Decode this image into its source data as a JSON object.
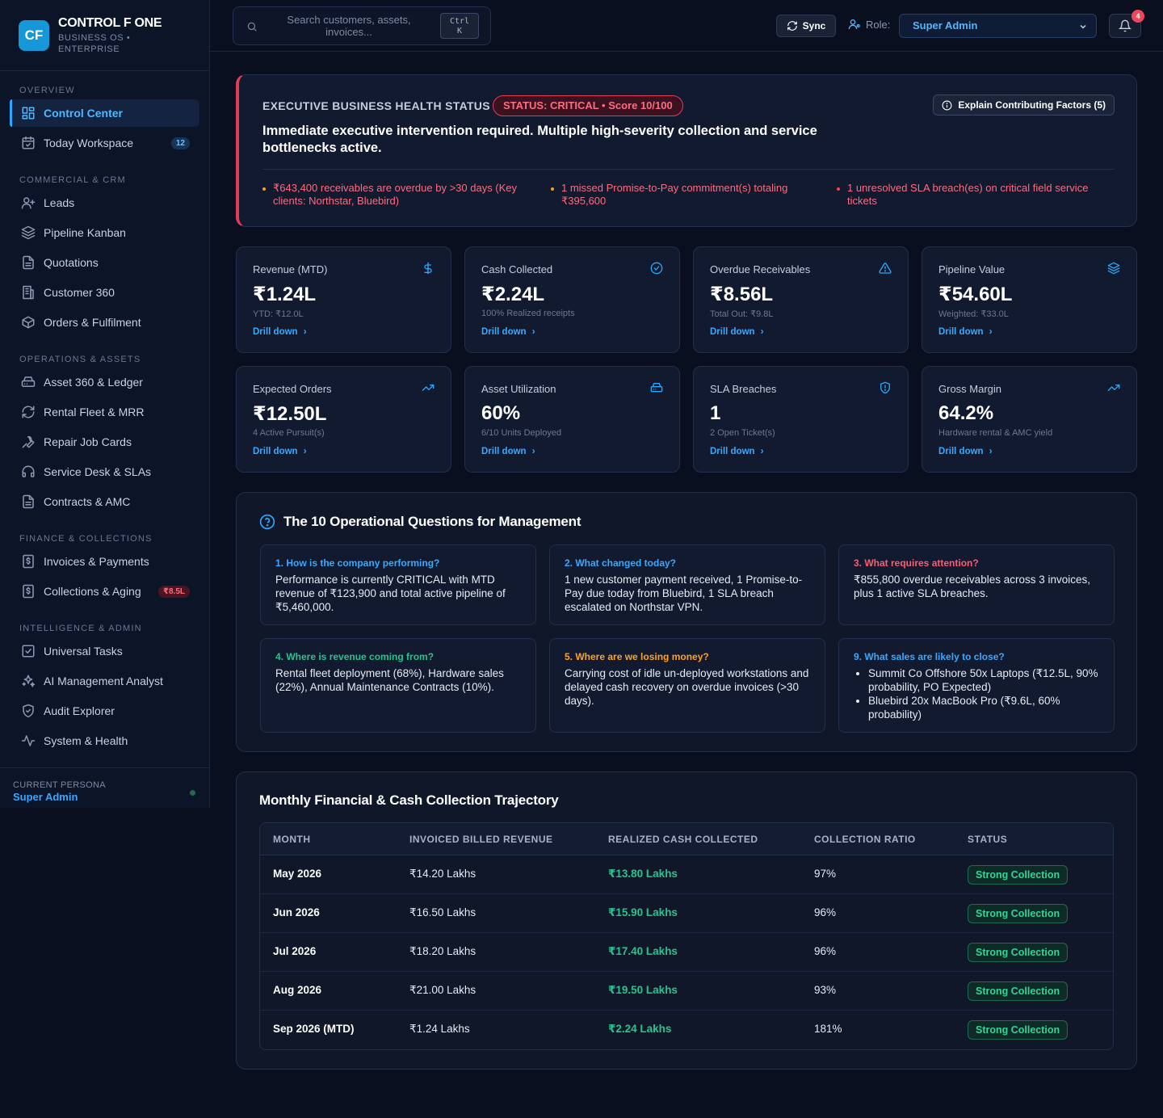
{
  "brand": {
    "logo": "CF",
    "name": "CONTROL F ONE",
    "sub": "BUSINESS OS • ENTERPRISE"
  },
  "sidebar": {
    "sections": [
      {
        "heading": "OVERVIEW",
        "items": [
          {
            "label": "Control Center",
            "icon": "grid-icon",
            "active": true
          },
          {
            "label": "Today Workspace",
            "icon": "calendar-icon",
            "badge": "12"
          }
        ]
      },
      {
        "heading": "COMMERCIAL & CRM",
        "items": [
          {
            "label": "Leads",
            "icon": "user-plus-icon"
          },
          {
            "label": "Pipeline Kanban",
            "icon": "layers-icon"
          },
          {
            "label": "Quotations",
            "icon": "document-icon"
          },
          {
            "label": "Customer 360",
            "icon": "building-icon"
          },
          {
            "label": "Orders & Fulfilment",
            "icon": "package-icon"
          }
        ]
      },
      {
        "heading": "OPERATIONS & ASSETS",
        "items": [
          {
            "label": "Asset 360 & Ledger",
            "icon": "drive-icon"
          },
          {
            "label": "Rental Fleet & MRR",
            "icon": "refresh-icon"
          },
          {
            "label": "Repair Job Cards",
            "icon": "wrench-icon"
          },
          {
            "label": "Service Desk & SLAs",
            "icon": "headset-icon"
          },
          {
            "label": "Contracts & AMC",
            "icon": "document-icon"
          }
        ]
      },
      {
        "heading": "FINANCE & COLLECTIONS",
        "items": [
          {
            "label": "Invoices & Payments",
            "icon": "invoice-icon"
          },
          {
            "label": "Collections & Aging",
            "icon": "invoice-icon",
            "badge": "₹8.5L"
          }
        ]
      },
      {
        "heading": "INTELLIGENCE & ADMIN",
        "items": [
          {
            "label": "Universal Tasks",
            "icon": "check-square-icon"
          },
          {
            "label": "AI Management Analyst",
            "icon": "sparkles-icon"
          },
          {
            "label": "Audit Explorer",
            "icon": "shield-icon"
          },
          {
            "label": "System & Health",
            "icon": "activity-icon"
          }
        ]
      }
    ]
  },
  "persona": {
    "label": "CURRENT PERSONA",
    "name": "Super Admin"
  },
  "topbar": {
    "search_placeholder": "Search customers, assets, invoices...",
    "shortcut_line1": "Ctrl",
    "shortcut_line2": "K",
    "sync_label": "Sync",
    "role_label": "Role:",
    "role_value": "Super Admin",
    "notification_count": "4"
  },
  "health": {
    "title": "EXECUTIVE BUSINESS HEALTH STATUS",
    "status": "STATUS: CRITICAL • Score 10/100",
    "explain_label": "Explain Contributing Factors (5)",
    "message": "Immediate executive intervention required. Multiple high-severity collection and service bottlenecks active.",
    "alerts": [
      {
        "text": "₹643,400 receivables are overdue by >30 days (Key clients: Northstar, Bluebird)",
        "color": "#ff9f1a"
      },
      {
        "text": "1 missed Promise-to-Pay commitment(s) totaling ₹395,600",
        "color": "#ff9f1a"
      },
      {
        "text": "1 unresolved SLA breach(es) on critical field service tickets",
        "color": "#ff3b55"
      }
    ]
  },
  "kpis": [
    {
      "label": "Revenue (MTD)",
      "icon": "dollar-icon",
      "value": "₹1.24L",
      "sub": "YTD: ₹12.0L",
      "link": "Drill down"
    },
    {
      "label": "Cash Collected",
      "icon": "check-circle-icon",
      "value": "₹2.24L",
      "sub": "100% Realized receipts",
      "link": "Drill down"
    },
    {
      "label": "Overdue Receivables",
      "icon": "warning-icon",
      "value": "₹8.56L",
      "sub": "Total Out: ₹9.8L",
      "link": "Drill down"
    },
    {
      "label": "Pipeline Value",
      "icon": "layers-icon",
      "value": "₹54.60L",
      "sub": "Weighted: ₹33.0L",
      "link": "Drill down"
    },
    {
      "label": "Expected Orders",
      "icon": "trending-up-icon",
      "value": "₹12.50L",
      "sub": "4 Active Pursuit(s)",
      "link": "Drill down"
    },
    {
      "label": "Asset Utilization",
      "icon": "drive-icon",
      "value": "60%",
      "sub": "6/10 Units Deployed",
      "link": "Drill down"
    },
    {
      "label": "SLA Breaches",
      "icon": "shield-alert-icon",
      "value": "1",
      "sub": "2 Open Ticket(s)",
      "link": "Drill down"
    },
    {
      "label": "Gross Margin",
      "icon": "trending-up-icon",
      "value": "64.2%",
      "sub": "Hardware rental & AMC yield",
      "link": "Drill down"
    }
  ],
  "questions": {
    "title": "The 10 Operational Questions for Management",
    "cards": [
      {
        "head": "1. How is the company performing?",
        "color": "blue",
        "body": "Performance is currently CRITICAL with MTD revenue of ₹123,900 and total active pipeline of ₹5,460,000."
      },
      {
        "head": "2. What changed today?",
        "color": "blue",
        "body": "1 new customer payment received, 1 Promise-to-Pay due today from Bluebird, 1 SLA breach escalated on Northstar VPN."
      },
      {
        "head": "3. What requires attention?",
        "color": "red",
        "body": "₹855,800 overdue receivables across 3 invoices, plus 1 active SLA breaches."
      },
      {
        "head": "4. Where is revenue coming from?",
        "color": "green",
        "body": "Rental fleet deployment (68%), Hardware sales (22%), Annual Maintenance Contracts (10%)."
      },
      {
        "head": "5. Where are we losing money?",
        "color": "orange",
        "body": "Carrying cost of idle un-deployed workstations and delayed cash recovery on overdue invoices (>30 days)."
      },
      {
        "head": "9. What sales are likely to close?",
        "color": "blue",
        "list": [
          "Summit Co Offshore 50x Laptops (₹12.5L, 90% probability, PO Expected)",
          "Bluebird 20x MacBook Pro (₹9.6L, 60% probability)"
        ]
      }
    ]
  },
  "finance": {
    "title": "Monthly Financial & Cash Collection Trajectory",
    "columns": [
      "MONTH",
      "INVOICED BILLED REVENUE",
      "REALIZED CASH COLLECTED",
      "COLLECTION RATIO",
      "STATUS"
    ],
    "rows": [
      {
        "month": "May 2026",
        "invoiced": "₹14.20 Lakhs",
        "cash": "₹13.80 Lakhs",
        "ratio": "97%",
        "status": "Strong Collection"
      },
      {
        "month": "Jun 2026",
        "invoiced": "₹16.50 Lakhs",
        "cash": "₹15.90 Lakhs",
        "ratio": "96%",
        "status": "Strong Collection"
      },
      {
        "month": "Jul 2026",
        "invoiced": "₹18.20 Lakhs",
        "cash": "₹17.40 Lakhs",
        "ratio": "96%",
        "status": "Strong Collection"
      },
      {
        "month": "Aug 2026",
        "invoiced": "₹21.00 Lakhs",
        "cash": "₹19.50 Lakhs",
        "ratio": "93%",
        "status": "Strong Collection"
      },
      {
        "month": "Sep 2026 (MTD)",
        "invoiced": "₹1.24 Lakhs",
        "cash": "₹2.24 Lakhs",
        "ratio": "181%",
        "status": "Strong Collection"
      }
    ]
  }
}
